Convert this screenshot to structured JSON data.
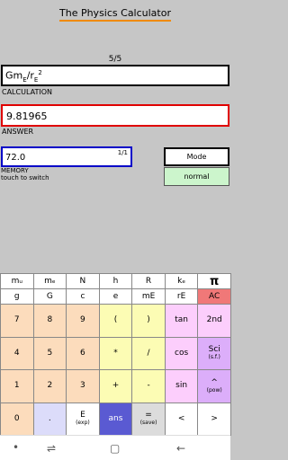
{
  "app": {
    "title": "The Physics Calculator"
  },
  "page_indicator": "5/5",
  "calculation": {
    "expr_base": "Gm",
    "expr_sub1": "E",
    "expr_slash": "/r",
    "expr_sub2": "E",
    "expr_sup": "2",
    "label": "CALCULATION"
  },
  "answer": {
    "value": "9.81965",
    "label": "ANSWER"
  },
  "memory": {
    "value": "72.0",
    "index": "1/1",
    "label1": "MEMORY",
    "label2": "touch to switch"
  },
  "mode": {
    "label": "Mode",
    "value": "normal"
  },
  "colors": {
    "accent": "#f08a00",
    "answer_border": "#e00000",
    "memory_border": "#0000c8",
    "num_key": "#fcdcbc",
    "op_key": "#fcfcb4",
    "fn_key": "#fccefc",
    "sci_key": "#dcaefa",
    "dot_key": "#dcdcfa",
    "ans_key": "#5a5ad2",
    "save_key": "#dcdcdc",
    "ac_key": "#f07878"
  },
  "keys": [
    {
      "label": "mᵤ",
      "sub": "",
      "color": "#ffffff",
      "name": "key-mu"
    },
    {
      "label": "mₑ",
      "sub": "",
      "color": "#ffffff",
      "name": "key-me"
    },
    {
      "label": "N",
      "sub": "",
      "color": "#ffffff",
      "name": "key-avogadro"
    },
    {
      "label": "h",
      "sub": "",
      "color": "#ffffff",
      "name": "key-planck"
    },
    {
      "label": "R",
      "sub": "",
      "color": "#ffffff",
      "name": "key-gas-constant"
    },
    {
      "label": "kₑ",
      "sub": "",
      "color": "#ffffff",
      "name": "key-coulomb"
    },
    {
      "label": "π",
      "sub": "",
      "color": "#ffffff",
      "name": "key-pi"
    },
    {
      "label": "g",
      "sub": "",
      "color": "#ffffff",
      "name": "key-g"
    },
    {
      "label": "G",
      "sub": "",
      "color": "#ffffff",
      "name": "key-gravitational"
    },
    {
      "label": "c",
      "sub": "",
      "color": "#ffffff",
      "name": "key-c"
    },
    {
      "label": "e",
      "sub": "",
      "color": "#ffffff",
      "name": "key-e"
    },
    {
      "label": "mE",
      "sub": "",
      "color": "#ffffff",
      "name": "key-earth-mass"
    },
    {
      "label": "rE",
      "sub": "",
      "color": "#ffffff",
      "name": "key-earth-radius"
    },
    {
      "label": "AC",
      "sub": "",
      "color": "#f07878",
      "name": "key-ac"
    },
    {
      "label": "7",
      "sub": "",
      "color": "#fcdcbc",
      "name": "key-7"
    },
    {
      "label": "8",
      "sub": "",
      "color": "#fcdcbc",
      "name": "key-8"
    },
    {
      "label": "9",
      "sub": "",
      "color": "#fcdcbc",
      "name": "key-9"
    },
    {
      "label": "(",
      "sub": "",
      "color": "#fcfcb4",
      "name": "key-open-paren"
    },
    {
      "label": ")",
      "sub": "",
      "color": "#fcfcb4",
      "name": "key-close-paren"
    },
    {
      "label": "tan",
      "sub": "",
      "color": "#fccefc",
      "name": "key-tan"
    },
    {
      "label": "2nd",
      "sub": "",
      "color": "#fccefc",
      "name": "key-2nd"
    },
    {
      "label": "4",
      "sub": "",
      "color": "#fcdcbc",
      "name": "key-4"
    },
    {
      "label": "5",
      "sub": "",
      "color": "#fcdcbc",
      "name": "key-5"
    },
    {
      "label": "6",
      "sub": "",
      "color": "#fcdcbc",
      "name": "key-6"
    },
    {
      "label": "*",
      "sub": "",
      "color": "#fcfcb4",
      "name": "key-multiply"
    },
    {
      "label": "/",
      "sub": "",
      "color": "#fcfcb4",
      "name": "key-divide"
    },
    {
      "label": "cos",
      "sub": "",
      "color": "#fccefc",
      "name": "key-cos"
    },
    {
      "label": "Sci",
      "sub": "(s.f.)",
      "color": "#dcaefa",
      "name": "key-sci"
    },
    {
      "label": "1",
      "sub": "",
      "color": "#fcdcbc",
      "name": "key-1"
    },
    {
      "label": "2",
      "sub": "",
      "color": "#fcdcbc",
      "name": "key-2"
    },
    {
      "label": "3",
      "sub": "",
      "color": "#fcdcbc",
      "name": "key-3"
    },
    {
      "label": "+",
      "sub": "",
      "color": "#fcfcb4",
      "name": "key-plus"
    },
    {
      "label": "-",
      "sub": "",
      "color": "#fcfcb4",
      "name": "key-minus"
    },
    {
      "label": "sin",
      "sub": "",
      "color": "#fccefc",
      "name": "key-sin"
    },
    {
      "label": "^",
      "sub": "(pow)",
      "color": "#dcaefa",
      "name": "key-pow"
    },
    {
      "label": "0",
      "sub": "",
      "color": "#fcdcbc",
      "name": "key-0"
    },
    {
      "label": ".",
      "sub": "",
      "color": "#dcdcfa",
      "name": "key-dot"
    },
    {
      "label": "E",
      "sub": "(exp)",
      "color": "#ffffff",
      "name": "key-exp"
    },
    {
      "label": "ans",
      "sub": "",
      "color": "#5a5ad2",
      "name": "key-ans"
    },
    {
      "label": "=",
      "sub": "(save)",
      "color": "#dcdcdc",
      "name": "key-save"
    },
    {
      "label": "<",
      "sub": "",
      "color": "#ffffff",
      "name": "key-left"
    },
    {
      "label": ">",
      "sub": "",
      "color": "#ffffff",
      "name": "key-right"
    }
  ],
  "navbar": [
    "menu-dot-icon",
    "recent-apps-icon",
    "home-icon",
    "back-icon"
  ]
}
